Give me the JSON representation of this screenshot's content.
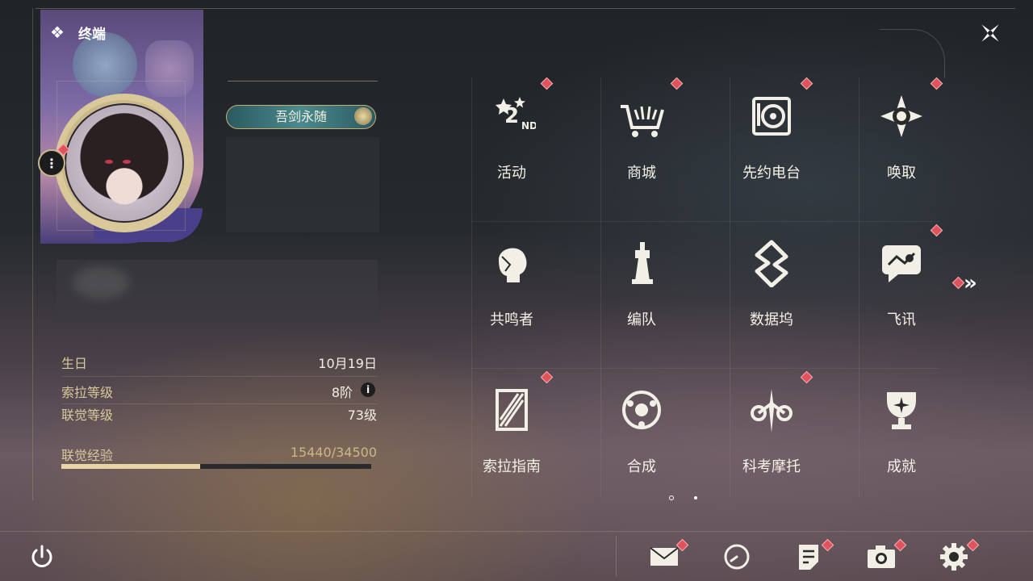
{
  "header": {
    "terminal_label": "终端"
  },
  "profile": {
    "title_badge": "吾剑永随",
    "stats": [
      {
        "label": "生日",
        "value": "10月19日"
      },
      {
        "label": "索拉等级",
        "value": "8阶"
      },
      {
        "label": "联觉等级",
        "value": "73级"
      }
    ],
    "xp": {
      "label": "联觉经验",
      "value": "15440/34500",
      "progress": 0.4476
    }
  },
  "menu": {
    "items": [
      {
        "label": "活动",
        "icon": "event-icon",
        "badge": true
      },
      {
        "label": "商城",
        "icon": "shop-icon",
        "badge": true
      },
      {
        "label": "先约电台",
        "icon": "radio-icon",
        "badge": true
      },
      {
        "label": "唤取",
        "icon": "convene-icon",
        "badge": true
      },
      {
        "label": "共鸣者",
        "icon": "resonator-icon",
        "badge": false
      },
      {
        "label": "编队",
        "icon": "team-icon",
        "badge": false
      },
      {
        "label": "数据坞",
        "icon": "data-bank-icon",
        "badge": false
      },
      {
        "label": "飞讯",
        "icon": "message-icon",
        "badge": true
      },
      {
        "label": "索拉指南",
        "icon": "guidebook-icon",
        "badge": true
      },
      {
        "label": "合成",
        "icon": "synthesis-icon",
        "badge": false
      },
      {
        "label": "科考摩托",
        "icon": "motorcycle-icon",
        "badge": true
      },
      {
        "label": "成就",
        "icon": "achievement-icon",
        "badge": false
      }
    ],
    "next_page_icon": "double-chevron-right-icon",
    "page_indicator": {
      "current": 1,
      "total": 2
    }
  },
  "bottom_bar": {
    "power_icon": "power-icon",
    "icons": [
      "mail-icon",
      "clock-icon",
      "notice-icon",
      "camera-icon",
      "settings-icon"
    ]
  },
  "colors": {
    "accent_gold": "#d8c89a",
    "badge_red": "#e0525c",
    "xp_fill": "#e8d4a4"
  }
}
